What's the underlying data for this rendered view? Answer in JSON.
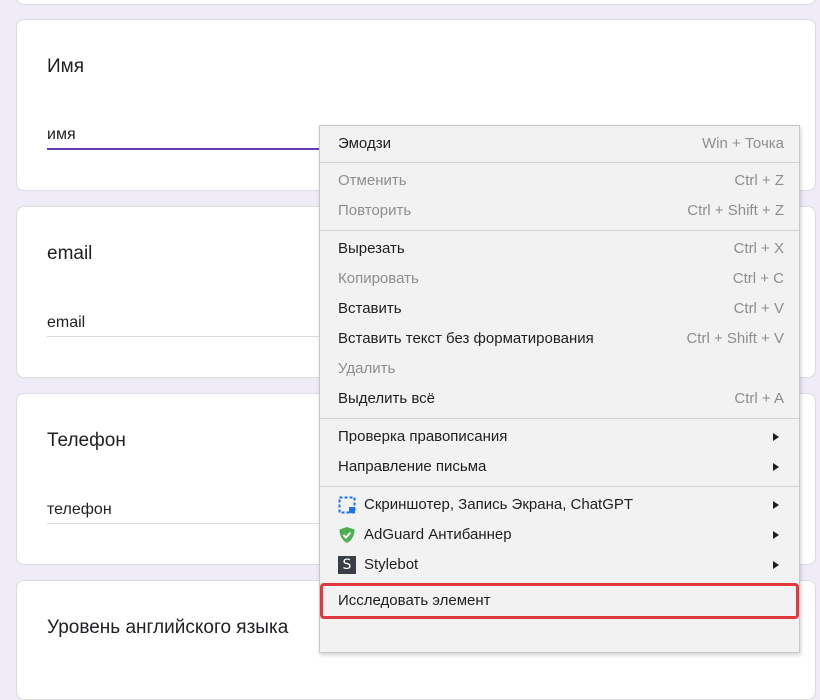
{
  "form": {
    "cards": [
      {
        "title": "",
        "value": ""
      },
      {
        "title": "Имя",
        "value": "имя"
      },
      {
        "title": "email",
        "value": "email"
      },
      {
        "title": "Телефон",
        "value": "телефон"
      },
      {
        "title": "Уровень английского языка",
        "value": ""
      }
    ],
    "accent_color": "#673ab7"
  },
  "context_menu": {
    "items": {
      "emoji": {
        "label": "Эмодзи",
        "shortcut": "Win + Точка"
      },
      "undo": {
        "label": "Отменить",
        "shortcut": "Ctrl + Z"
      },
      "redo": {
        "label": "Повторить",
        "shortcut": "Ctrl + Shift + Z"
      },
      "cut": {
        "label": "Вырезать",
        "shortcut": "Ctrl + X"
      },
      "copy": {
        "label": "Копировать",
        "shortcut": "Ctrl + C"
      },
      "paste": {
        "label": "Вставить",
        "shortcut": "Ctrl + V"
      },
      "paste_plain": {
        "label": "Вставить текст без форматирования",
        "shortcut": "Ctrl + Shift + V"
      },
      "delete": {
        "label": "Удалить"
      },
      "select_all": {
        "label": "Выделить всё",
        "shortcut": "Ctrl + A"
      },
      "spellcheck": {
        "label": "Проверка правописания"
      },
      "writing_direction": {
        "label": "Направление письма"
      },
      "screenshoter": {
        "label": "Скриншотер, Запись Экрана, ChatGPT",
        "icon": "screenshot-icon"
      },
      "adguard": {
        "label": "AdGuard Антибаннер",
        "icon": "shield-icon"
      },
      "stylebot": {
        "label": "Stylebot",
        "icon": "stylebot-icon",
        "icon_letter": "S"
      },
      "inspect": {
        "label": "Исследовать элемент"
      }
    },
    "highlight_color": "#e0393e"
  }
}
